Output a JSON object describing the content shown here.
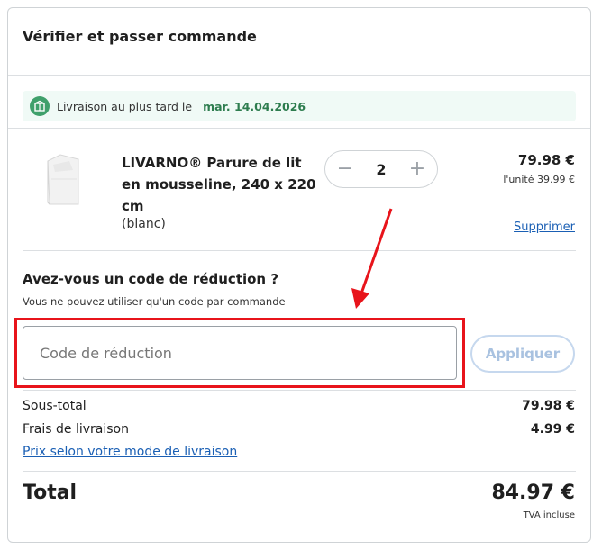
{
  "header": {
    "title": "Vérifier et passer commande"
  },
  "delivery": {
    "icon": "delivery-box-icon",
    "text": "Livraison au plus tard le",
    "date": "mar. 14.04.2026"
  },
  "product": {
    "name": "LIVARNO® Parure de lit en mousseline, 240 x 220 cm",
    "variant": "(blanc)",
    "quantity": "2",
    "price": "79.98 €",
    "unit_price": "l'unité 39.99 €",
    "remove_label": "Supprimer"
  },
  "discount": {
    "title": "Avez-vous un code de réduction ?",
    "hint": "Vous ne pouvez utiliser qu'un code par commande",
    "placeholder": "Code de réduction",
    "apply_label": "Appliquer"
  },
  "summary": {
    "subtotal_label": "Sous-total",
    "subtotal_value": "79.98 €",
    "shipping_label": "Frais de livraison",
    "shipping_value": "4.99 €",
    "shipping_link": "Prix selon votre mode de livraison",
    "total_label": "Total",
    "total_value": "84.97 €",
    "vat_note": "TVA incluse"
  },
  "colors": {
    "accent_link": "#1a5fb4",
    "delivery_green": "#2e7d4f",
    "annotation_red": "#e8141b"
  }
}
